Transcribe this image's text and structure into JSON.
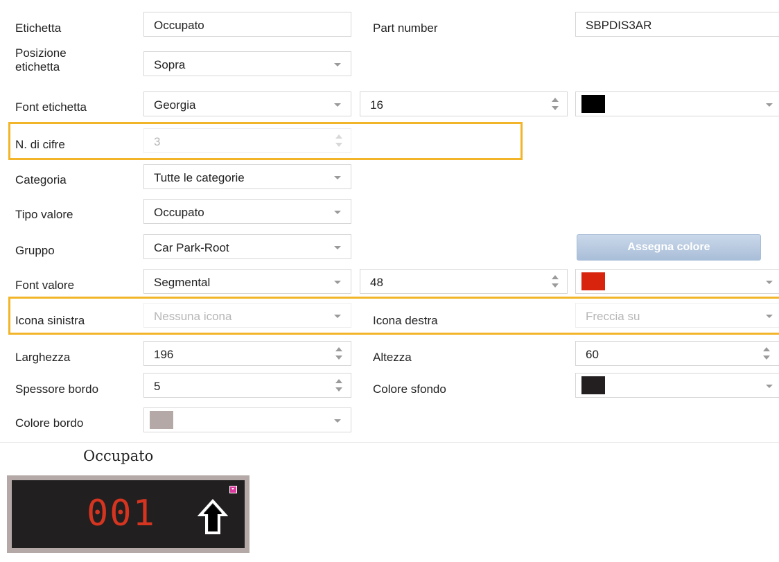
{
  "form": {
    "etichetta": {
      "label": "Etichetta",
      "value": "Occupato"
    },
    "part_number": {
      "label": "Part number",
      "value": "SBPDIS3AR"
    },
    "posizione": {
      "label_line1": "Posizione",
      "label_line2": "etichetta",
      "value": "Sopra"
    },
    "font_etichetta": {
      "label": "Font etichetta",
      "font": "Georgia",
      "size": "16",
      "color": "#000000"
    },
    "n_cifre": {
      "label": "N. di cifre",
      "value": "3"
    },
    "categoria": {
      "label": "Categoria",
      "value": "Tutte le categorie"
    },
    "tipo_valore": {
      "label": "Tipo valore",
      "value": "Occupato"
    },
    "gruppo": {
      "label": "Gruppo",
      "value": "Car Park-Root",
      "assign_button": "Assegna colore"
    },
    "font_valore": {
      "label": "Font valore",
      "font": "Segmental",
      "size": "48",
      "color": "#d8240d"
    },
    "icona_sinistra": {
      "label": "Icona sinistra",
      "value": "Nessuna icona"
    },
    "icona_destra": {
      "label": "Icona destra",
      "value": "Freccia su"
    },
    "larghezza": {
      "label": "Larghezza",
      "value": "196"
    },
    "altezza": {
      "label": "Altezza",
      "value": "60"
    },
    "spessore_bordo": {
      "label": "Spessore bordo",
      "value": "5"
    },
    "colore_sfondo": {
      "label": "Colore sfondo",
      "color": "#231f20"
    },
    "colore_bordo": {
      "label": "Colore bordo",
      "color": "#b5a9a8"
    }
  },
  "preview": {
    "title": "Occupato",
    "digits": "001",
    "digit_color": "#d53520",
    "background": "#211f1f",
    "border_color": "#b5a9a8",
    "right_icon": "arrow-up-icon"
  },
  "colors": {
    "highlight": "#f2b52a",
    "button": "#b8cae0"
  }
}
